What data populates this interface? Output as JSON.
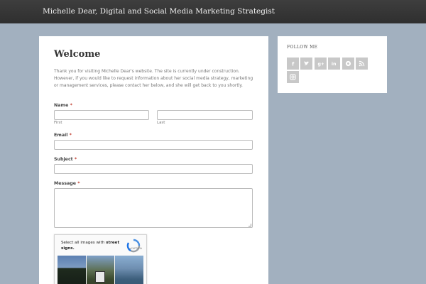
{
  "header": {
    "site_title": "Michelle Dear, Digital and Social Media Marketing Strategist"
  },
  "main": {
    "title": "Welcome",
    "intro": "Thank you for visiting Michelle Dear's website. The site is currently under construction. However, if you would like to request information about her social media strategy, marketing or management services, please contact her below, and she will get back to you shortly."
  },
  "form": {
    "required_marker": "*",
    "name_label": "Name",
    "first_sublabel": "First",
    "last_sublabel": "Last",
    "email_label": "Email",
    "subject_label": "Subject",
    "message_label": "Message"
  },
  "captcha": {
    "instruction_prefix": "Select all images with",
    "instruction_target": "street signs.",
    "brand_label": "reCAPTCHA"
  },
  "sidebar": {
    "widget_title": "FOLLOW ME",
    "social_icons": [
      "facebook-icon",
      "twitter-icon",
      "google-plus-icon",
      "linkedin-icon",
      "pinterest-icon",
      "rss-icon",
      "instagram-icon"
    ]
  },
  "colors": {
    "page_background": "#a2b0bf",
    "header_background": "#333333",
    "required_marker": "#c0392b",
    "social_button": "#c8c8c8"
  }
}
